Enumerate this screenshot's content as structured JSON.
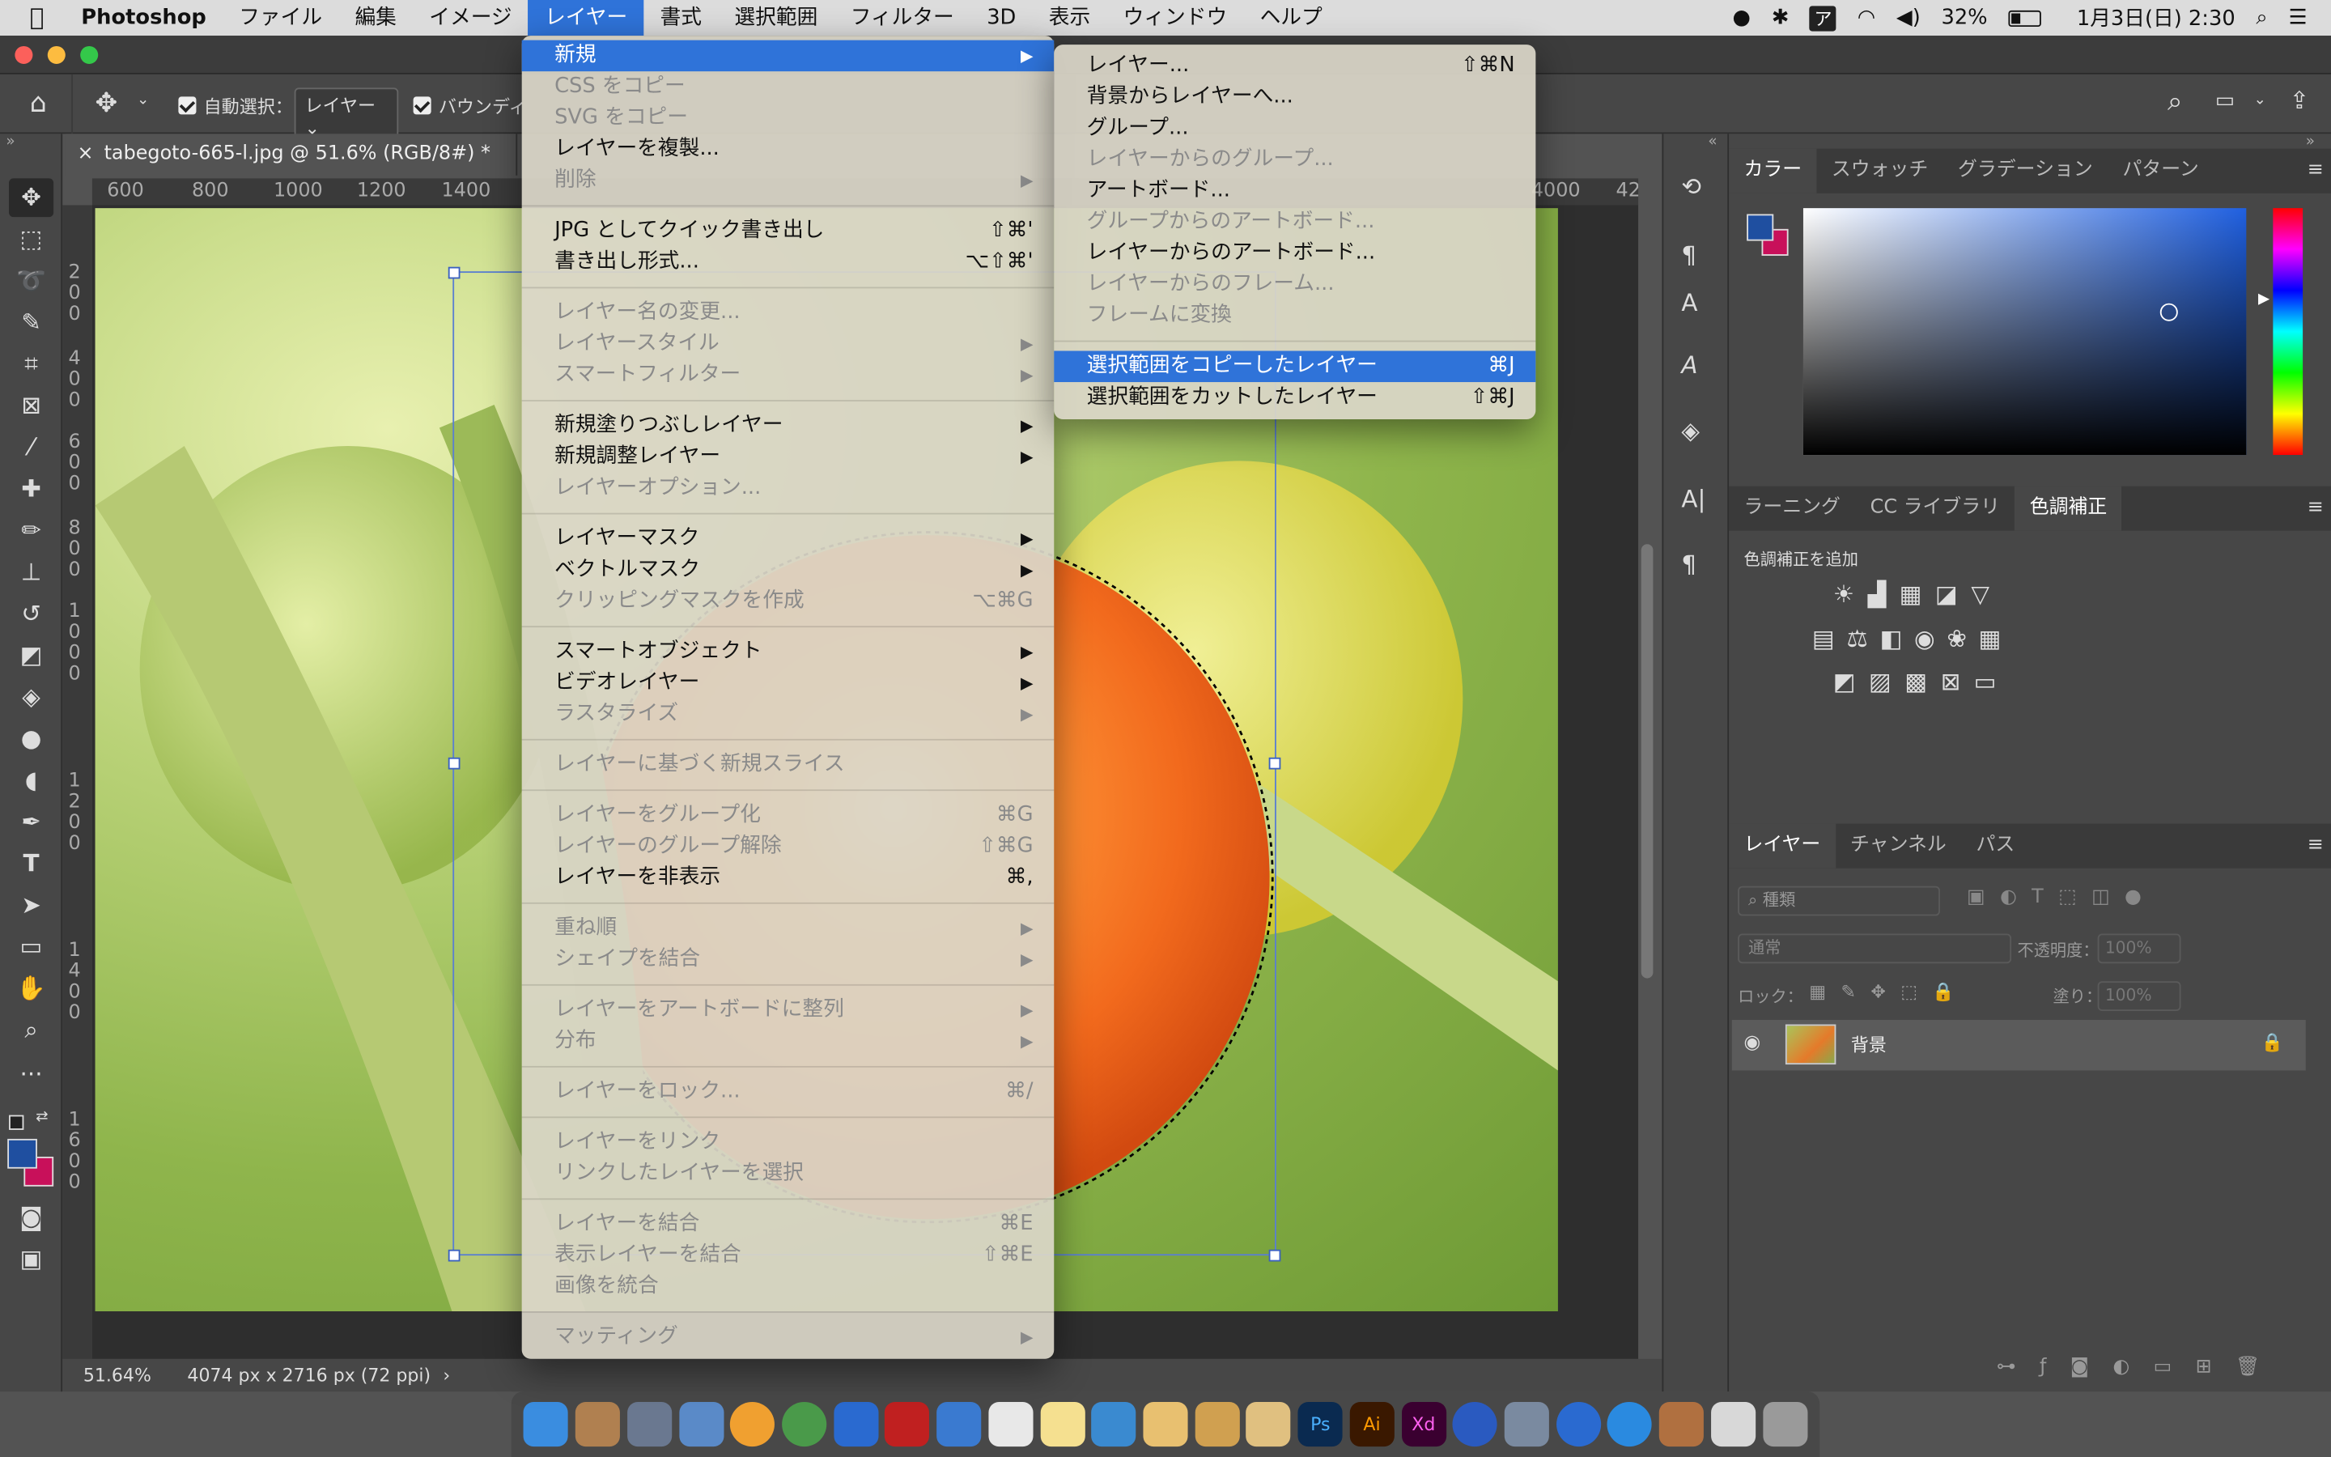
{
  "menubar": {
    "app": "Photoshop",
    "items": [
      "ファイル",
      "編集",
      "イメージ",
      "レイヤー",
      "書式",
      "選択範囲",
      "フィルター",
      "3D",
      "表示",
      "ウィンドウ",
      "ヘルプ"
    ],
    "battery": "32%",
    "datetime": "1月3日(日)  2:30"
  },
  "options": {
    "autoselect": "自動選択：",
    "autoselect_value": "レイヤー",
    "bounding": "バウンディ"
  },
  "document": {
    "tab": "tabegoto-665-l.jpg @ 51.6% (RGB/8#) *",
    "zoom": "51.64%",
    "size": "4074 px x 2716 px (72 ppi)",
    "ruler_top": [
      "600",
      "800",
      "1000",
      "1200",
      "1400",
      "4000",
      "42"
    ],
    "ruler_left": [
      "2",
      "0",
      "0",
      "4",
      "0",
      "0",
      "6",
      "0",
      "0",
      "8",
      "0",
      "0",
      "1",
      "0",
      "0",
      "0",
      "1",
      "2",
      "0",
      "0",
      "1",
      "4",
      "0",
      "0",
      "1",
      "6",
      "0",
      "0"
    ]
  },
  "menu_layer": {
    "groups": [
      [
        {
          "label": "新規",
          "sub": true,
          "sel": true
        },
        {
          "label": "CSS をコピー",
          "dis": true
        },
        {
          "label": "SVG をコピー",
          "dis": true
        },
        {
          "label": "レイヤーを複製..."
        },
        {
          "label": "削除",
          "sub": true,
          "dis": true
        }
      ],
      [
        {
          "label": "JPG としてクイック書き出し",
          "sc": "⇧⌘'"
        },
        {
          "label": "書き出し形式...",
          "sc": "⌥⇧⌘'"
        }
      ],
      [
        {
          "label": "レイヤー名の変更...",
          "dis": true
        },
        {
          "label": "レイヤースタイル",
          "sub": true,
          "dis": true
        },
        {
          "label": "スマートフィルター",
          "sub": true,
          "dis": true
        }
      ],
      [
        {
          "label": "新規塗りつぶしレイヤー",
          "sub": true
        },
        {
          "label": "新規調整レイヤー",
          "sub": true
        },
        {
          "label": "レイヤーオプション...",
          "dis": true
        }
      ],
      [
        {
          "label": "レイヤーマスク",
          "sub": true
        },
        {
          "label": "ベクトルマスク",
          "sub": true
        },
        {
          "label": "クリッピングマスクを作成",
          "sc": "⌥⌘G",
          "dis": true
        }
      ],
      [
        {
          "label": "スマートオブジェクト",
          "sub": true
        },
        {
          "label": "ビデオレイヤー",
          "sub": true
        },
        {
          "label": "ラスタライズ",
          "sub": true,
          "dis": true
        }
      ],
      [
        {
          "label": "レイヤーに基づく新規スライス",
          "dis": true
        }
      ],
      [
        {
          "label": "レイヤーをグループ化",
          "sc": "⌘G",
          "dis": true
        },
        {
          "label": "レイヤーのグループ解除",
          "sc": "⇧⌘G",
          "dis": true
        },
        {
          "label": "レイヤーを非表示",
          "sc": "⌘,"
        }
      ],
      [
        {
          "label": "重ね順",
          "sub": true,
          "dis": true
        },
        {
          "label": "シェイプを結合",
          "sub": true,
          "dis": true
        }
      ],
      [
        {
          "label": "レイヤーをアートボードに整列",
          "sub": true,
          "dis": true
        },
        {
          "label": "分布",
          "sub": true,
          "dis": true
        }
      ],
      [
        {
          "label": "レイヤーをロック...",
          "sc": "⌘/",
          "dis": true
        }
      ],
      [
        {
          "label": "レイヤーをリンク",
          "dis": true
        },
        {
          "label": "リンクしたレイヤーを選択",
          "dis": true
        }
      ],
      [
        {
          "label": "レイヤーを結合",
          "sc": "⌘E",
          "dis": true
        },
        {
          "label": "表示レイヤーを結合",
          "sc": "⇧⌘E",
          "dis": true
        },
        {
          "label": "画像を統合",
          "dis": true
        }
      ],
      [
        {
          "label": "マッティング",
          "sub": true,
          "dis": true
        }
      ]
    ]
  },
  "menu_new": {
    "groups": [
      [
        {
          "label": "レイヤー...",
          "sc": "⇧⌘N"
        },
        {
          "label": "背景からレイヤーへ..."
        },
        {
          "label": "グループ..."
        },
        {
          "label": "レイヤーからのグループ...",
          "dis": true
        },
        {
          "label": "アートボード..."
        },
        {
          "label": "グループからのアートボード...",
          "dis": true
        },
        {
          "label": "レイヤーからのアートボード..."
        },
        {
          "label": "レイヤーからのフレーム...",
          "dis": true
        },
        {
          "label": "フレームに変換",
          "dis": true
        }
      ],
      [
        {
          "label": "選択範囲をコピーしたレイヤー",
          "sc": "⌘J",
          "sel": true
        },
        {
          "label": "選択範囲をカットしたレイヤー",
          "sc": "⇧⌘J"
        }
      ]
    ]
  },
  "panels": {
    "color_tabs": [
      "カラー",
      "スウォッチ",
      "グラデーション",
      "パターン"
    ],
    "adj_tabs": [
      "ラーニング",
      "CC ライブラリ",
      "色調補正"
    ],
    "adj_title": "色調補正を追加",
    "layer_tabs": [
      "レイヤー",
      "チャンネル",
      "パス"
    ],
    "layer_filter": "種類",
    "blend": "通常",
    "opacity_label": "不透明度：",
    "opacity": "100%",
    "lock_label": "ロック：",
    "fill_label": "塗り：",
    "fill": "100%",
    "layer_name": "背景"
  },
  "colors": {
    "accent": "#2f73d9",
    "fg": "#1f4fa0",
    "bg": "#c8105a"
  }
}
